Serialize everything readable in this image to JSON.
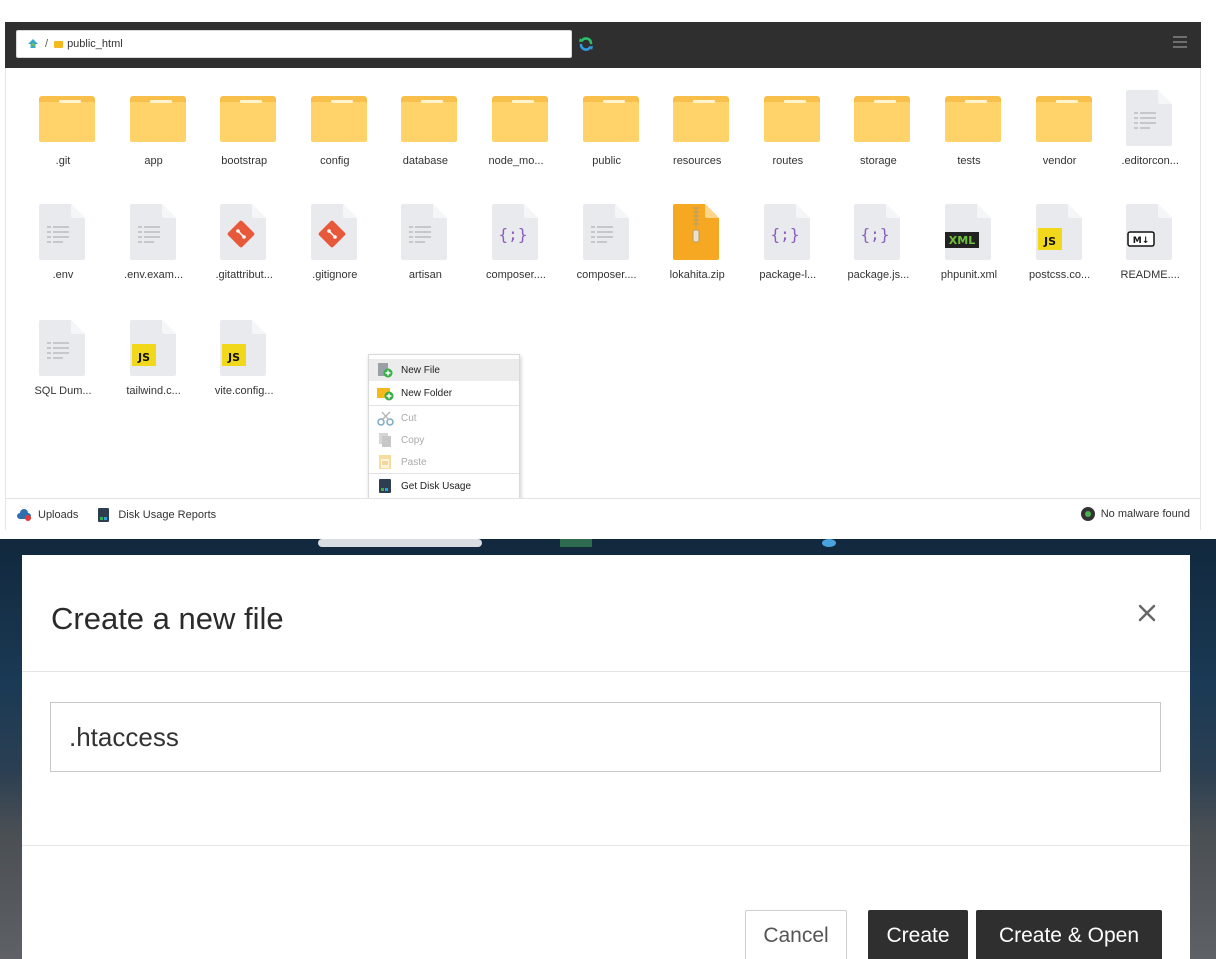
{
  "file_manager": {
    "path": {
      "root_icon": "home-up-icon",
      "separator": "/",
      "current_folder": "public_html"
    },
    "files": [
      {
        "name": ".git",
        "kind": "folder"
      },
      {
        "name": "app",
        "kind": "folder"
      },
      {
        "name": "bootstrap",
        "kind": "folder"
      },
      {
        "name": "config",
        "kind": "folder"
      },
      {
        "name": "database",
        "kind": "folder"
      },
      {
        "name": "node_mo...",
        "kind": "folder"
      },
      {
        "name": "public",
        "kind": "folder"
      },
      {
        "name": "resources",
        "kind": "folder"
      },
      {
        "name": "routes",
        "kind": "folder"
      },
      {
        "name": "storage",
        "kind": "folder"
      },
      {
        "name": "tests",
        "kind": "folder"
      },
      {
        "name": "vendor",
        "kind": "folder"
      },
      {
        "name": ".editorcon...",
        "kind": "text"
      },
      {
        "name": ".env",
        "kind": "text"
      },
      {
        "name": ".env.exam...",
        "kind": "text"
      },
      {
        "name": ".gitattribut...",
        "kind": "git"
      },
      {
        "name": ".gitignore",
        "kind": "git"
      },
      {
        "name": "artisan",
        "kind": "text"
      },
      {
        "name": "composer....",
        "kind": "json"
      },
      {
        "name": "composer....",
        "kind": "text"
      },
      {
        "name": "lokahita.zip",
        "kind": "zip"
      },
      {
        "name": "package-l...",
        "kind": "json"
      },
      {
        "name": "package.js...",
        "kind": "json"
      },
      {
        "name": "phpunit.xml",
        "kind": "xml"
      },
      {
        "name": "postcss.co...",
        "kind": "js"
      },
      {
        "name": "README....",
        "kind": "md"
      },
      {
        "name": "SQL Dum...",
        "kind": "text"
      },
      {
        "name": "tailwind.c...",
        "kind": "js"
      },
      {
        "name": "vite.config...",
        "kind": "js"
      }
    ],
    "badges": {
      "json": "{;}",
      "xml": "XML",
      "js": "JS",
      "md": "M↓"
    },
    "context_menu": {
      "new_file": "New File",
      "new_folder": "New Folder",
      "cut": "Cut",
      "copy": "Copy",
      "paste": "Paste",
      "get_disk_usage": "Get Disk Usage"
    },
    "status_bar": {
      "uploads": "Uploads",
      "disk_usage_reports": "Disk Usage Reports",
      "malware": "No malware found"
    }
  },
  "modal": {
    "title": "Create a new file",
    "filename_value": ".htaccess",
    "cancel_label": "Cancel",
    "create_label": "Create",
    "create_open_label": "Create & Open"
  },
  "colors": {
    "toolbar": "#2f2f2f",
    "folder": "#ffd36a",
    "doc": "#e8eaed",
    "git": "#e8583b",
    "json_purple": "#8b5fbf",
    "js_yellow": "#f2d81b",
    "xml_green": "#6ec13a",
    "zip_orange": "#f7a823",
    "button_dark": "#2f2f2f"
  }
}
